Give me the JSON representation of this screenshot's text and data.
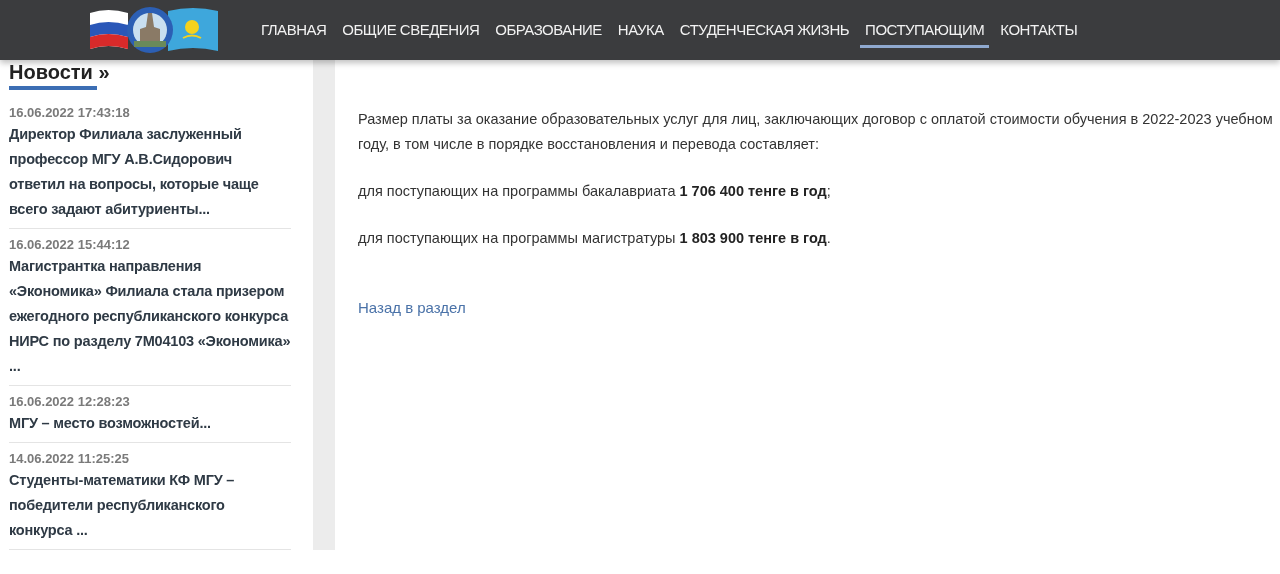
{
  "nav": [
    {
      "label": "ГЛАВНАЯ",
      "selected": false
    },
    {
      "label": "ОБЩИЕ СВЕДЕНИЯ",
      "selected": false
    },
    {
      "label": "ОБРАЗОВАНИЕ",
      "selected": false
    },
    {
      "label": "НАУКА",
      "selected": false
    },
    {
      "label": "СТУДЕНЧЕСКАЯ ЖИЗНЬ",
      "selected": false
    },
    {
      "label": "ПОСТУПАЮЩИМ",
      "selected": true
    },
    {
      "label": "КОНТАКТЫ",
      "selected": false
    }
  ],
  "sidebar": {
    "heading": "Новости »",
    "items": [
      {
        "date": "16.06.2022 17:43:18",
        "title": "Директор Филиала заслуженный профессор МГУ А.В.Сидорович ответил на вопросы, которые чаще всего задают абитуриенты..."
      },
      {
        "date": "16.06.2022 15:44:12",
        "title": "Магистрантка направления «Экономика» Филиала стала призером ежегодного республиканского конкурса НИРС по разделу 7М04103 «Экономика» ..."
      },
      {
        "date": "16.06.2022 12:28:23",
        "title": "МГУ – место возможностей..."
      },
      {
        "date": "14.06.2022 11:25:25",
        "title": "Студенты-математики КФ МГУ – победители республиканского конкурса ..."
      }
    ]
  },
  "content": {
    "paragraphs": [
      "Размер платы за оказание образовательных услуг для лиц, заключающих договор с оплатой стоимости обучения в 2022-2023 учебном году, в том числе в порядке восстановления и перевода составляет:",
      "для поступающих на программы бакалавриата **1 706 400 тенге в год**;",
      "для поступающих на программы магистратуры **1 803 900 тенге в год**."
    ],
    "back_link": "Назад в раздел"
  }
}
